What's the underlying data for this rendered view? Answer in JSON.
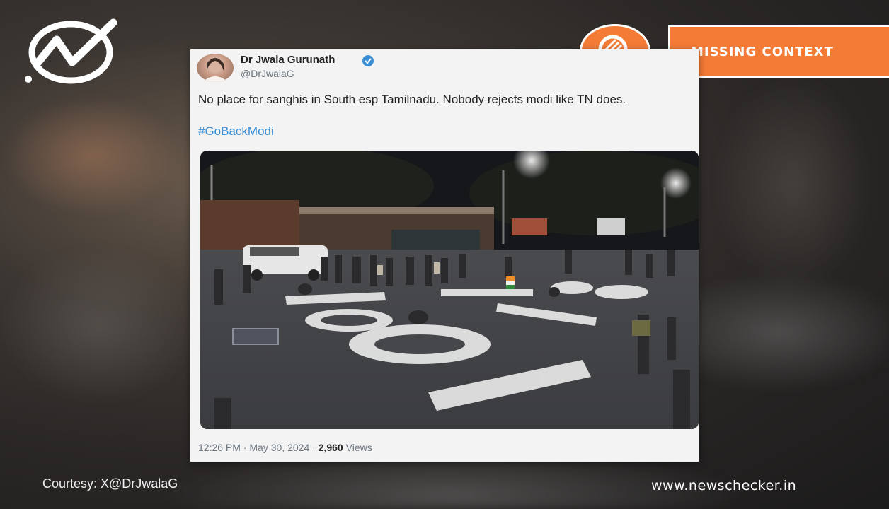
{
  "brand": {
    "logo_icon": "newschecker-checkmark-icon",
    "badge_icon": "magnifier-icon",
    "verdict_label": "MISSING CONTEXT",
    "accent_color": "#f47b36",
    "website": "www.newschecker.in"
  },
  "tweet": {
    "author_name": "Dr Jwala Gurunath",
    "handle": "@DrJwalaG",
    "verified_icon": "verified-badge-icon",
    "text": "No place for sanghis in South esp Tamilnadu. Nobody rejects modi like TN does.",
    "hashtag": "#GoBackModi",
    "time": "12:26 PM",
    "separator": "·",
    "date": "May 30, 2024",
    "views_count": "2,960",
    "views_label": "Views",
    "hashtag_color": "#3b8fd6"
  },
  "footer": {
    "courtesy": "Courtesy: X@DrJwalaG"
  }
}
